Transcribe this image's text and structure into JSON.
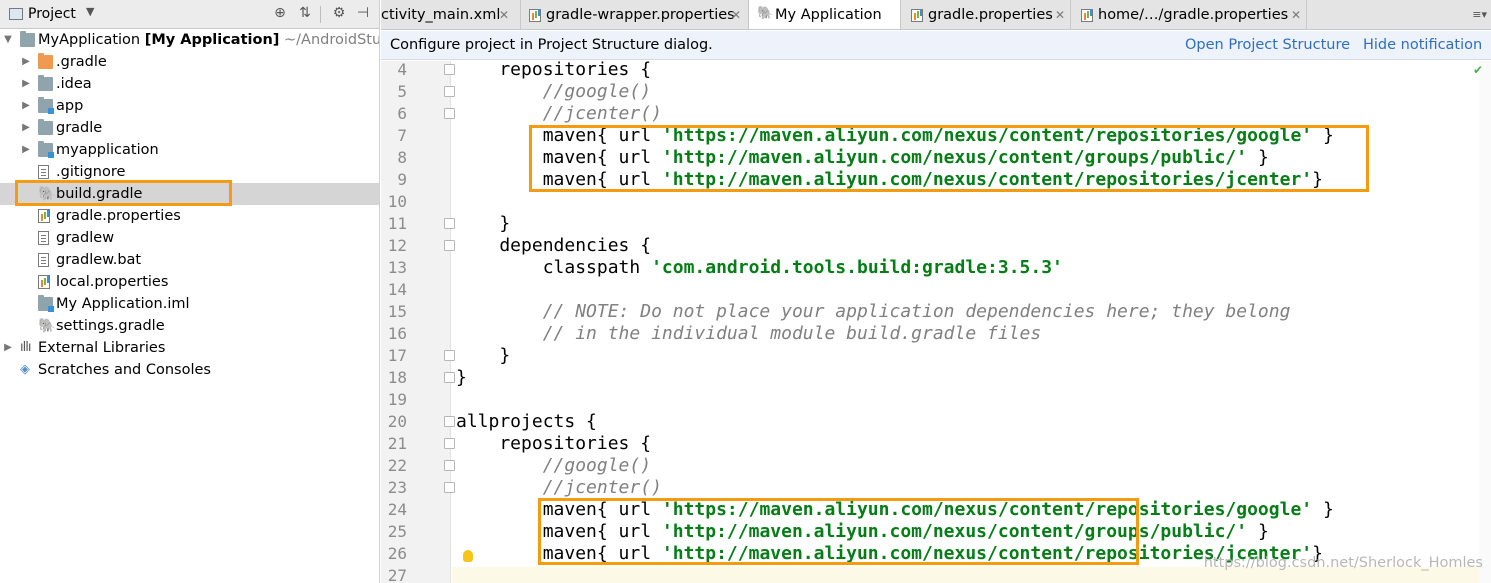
{
  "project_panel": {
    "title": "Project",
    "tree": [
      {
        "label": "MyApplication",
        "bold": "[My Application]",
        "path": "~/AndroidStudio",
        "icon": "folder-icon",
        "arrow": "▼",
        "level": 0
      },
      {
        "label": ".gradle",
        "icon": "folder-orange-icon",
        "arrow": "▶",
        "level": 1
      },
      {
        "label": ".idea",
        "icon": "folder-icon",
        "arrow": "▶",
        "level": 1
      },
      {
        "label": "app",
        "icon": "module-icon",
        "arrow": "▶",
        "level": 1
      },
      {
        "label": "gradle",
        "icon": "folder-icon",
        "arrow": "▶",
        "level": 1
      },
      {
        "label": "myapplication",
        "icon": "module-icon",
        "arrow": "▶",
        "level": 1
      },
      {
        "label": ".gitignore",
        "icon": "file-icon",
        "arrow": "",
        "level": 1
      },
      {
        "label": "build.gradle",
        "icon": "gradle-elephant-icon",
        "arrow": "",
        "level": 1
      },
      {
        "label": "gradle.properties",
        "icon": "properties-icon",
        "arrow": "",
        "level": 1
      },
      {
        "label": "gradlew",
        "icon": "file-icon",
        "arrow": "",
        "level": 1
      },
      {
        "label": "gradlew.bat",
        "icon": "file-icon",
        "arrow": "",
        "level": 1
      },
      {
        "label": "local.properties",
        "icon": "properties-icon",
        "arrow": "",
        "level": 1
      },
      {
        "label": "My Application.iml",
        "icon": "module-icon",
        "arrow": "",
        "level": 1
      },
      {
        "label": "settings.gradle",
        "icon": "gradle-elephant-icon",
        "arrow": "",
        "level": 1
      },
      {
        "label": "External Libraries",
        "icon": "libraries-icon",
        "arrow": "▶",
        "level": 0
      },
      {
        "label": "Scratches and Consoles",
        "icon": "scratch-icon",
        "arrow": "",
        "level": 0
      }
    ]
  },
  "tabs": [
    {
      "label": "ctivity_main.xml",
      "active": false,
      "icon": ""
    },
    {
      "label": "gradle-wrapper.properties",
      "active": false,
      "icon": "properties-icon"
    },
    {
      "label": "My Application",
      "active": true,
      "icon": "gradle-elephant-icon"
    },
    {
      "label": "gradle.properties",
      "active": false,
      "icon": "properties-icon"
    },
    {
      "label": "home/…/gradle.properties",
      "active": false,
      "icon": "properties-icon"
    }
  ],
  "notification": {
    "text": "Configure project in Project Structure dialog.",
    "open_link": "Open Project Structure",
    "hide_link": "Hide notification"
  },
  "code_lines": [
    {
      "num": "4",
      "text": "    repositories {",
      "type": "plain"
    },
    {
      "num": "5",
      "text": "        //google()",
      "type": "comment"
    },
    {
      "num": "6",
      "text": "        //jcenter()",
      "type": "comment"
    },
    {
      "num": "7",
      "pre": "        maven{ url ",
      "str": "'https://maven.aliyun.com/nexus/content/repositories/google'",
      "post": " }",
      "type": "maven"
    },
    {
      "num": "8",
      "pre": "        maven{ url ",
      "str": "'http://maven.aliyun.com/nexus/content/groups/public/'",
      "post": " }",
      "type": "maven"
    },
    {
      "num": "9",
      "pre": "        maven{ url ",
      "str": "'http://maven.aliyun.com/nexus/content/repositories/jcenter'",
      "post": "}",
      "type": "maven"
    },
    {
      "num": "10",
      "text": "",
      "type": "plain"
    },
    {
      "num": "11",
      "text": "    }",
      "type": "plain"
    },
    {
      "num": "12",
      "text": "    dependencies {",
      "type": "plain"
    },
    {
      "num": "13",
      "pre": "        classpath ",
      "str": "'com.android.tools.build:gradle:3.5.3'",
      "post": "",
      "type": "maven"
    },
    {
      "num": "14",
      "text": "",
      "type": "plain"
    },
    {
      "num": "15",
      "text": "        // NOTE: Do not place your application dependencies here; they belong",
      "type": "comment"
    },
    {
      "num": "16",
      "text": "        // in the individual module build.gradle files",
      "type": "comment"
    },
    {
      "num": "17",
      "text": "    }",
      "type": "plain"
    },
    {
      "num": "18",
      "text": "}",
      "type": "plain"
    },
    {
      "num": "19",
      "text": "",
      "type": "plain"
    },
    {
      "num": "20",
      "text": "allprojects {",
      "type": "plain"
    },
    {
      "num": "21",
      "text": "    repositories {",
      "type": "plain"
    },
    {
      "num": "22",
      "text": "        //google()",
      "type": "comment"
    },
    {
      "num": "23",
      "text": "        //jcenter()",
      "type": "comment"
    },
    {
      "num": "24",
      "pre": "        maven{ url ",
      "str": "'https://maven.aliyun.com/nexus/content/repositories/google'",
      "post": " }",
      "type": "maven"
    },
    {
      "num": "25",
      "pre": "        maven{ url ",
      "str": "'http://maven.aliyun.com/nexus/content/groups/public/'",
      "post": " }",
      "type": "maven"
    },
    {
      "num": "26",
      "pre": "        maven{ url ",
      "str": "'http://maven.aliyun.com/nexus/content/repositories/jcenter'",
      "post": "}",
      "type": "maven"
    },
    {
      "num": "27",
      "text": "",
      "type": "plain"
    }
  ],
  "watermark": "https://blog.csdn.net/Sherlock_Homles",
  "colors": {
    "highlight_box": "#f39c12",
    "string": "#067d17",
    "comment": "#808080",
    "link": "#2f6fbf"
  }
}
